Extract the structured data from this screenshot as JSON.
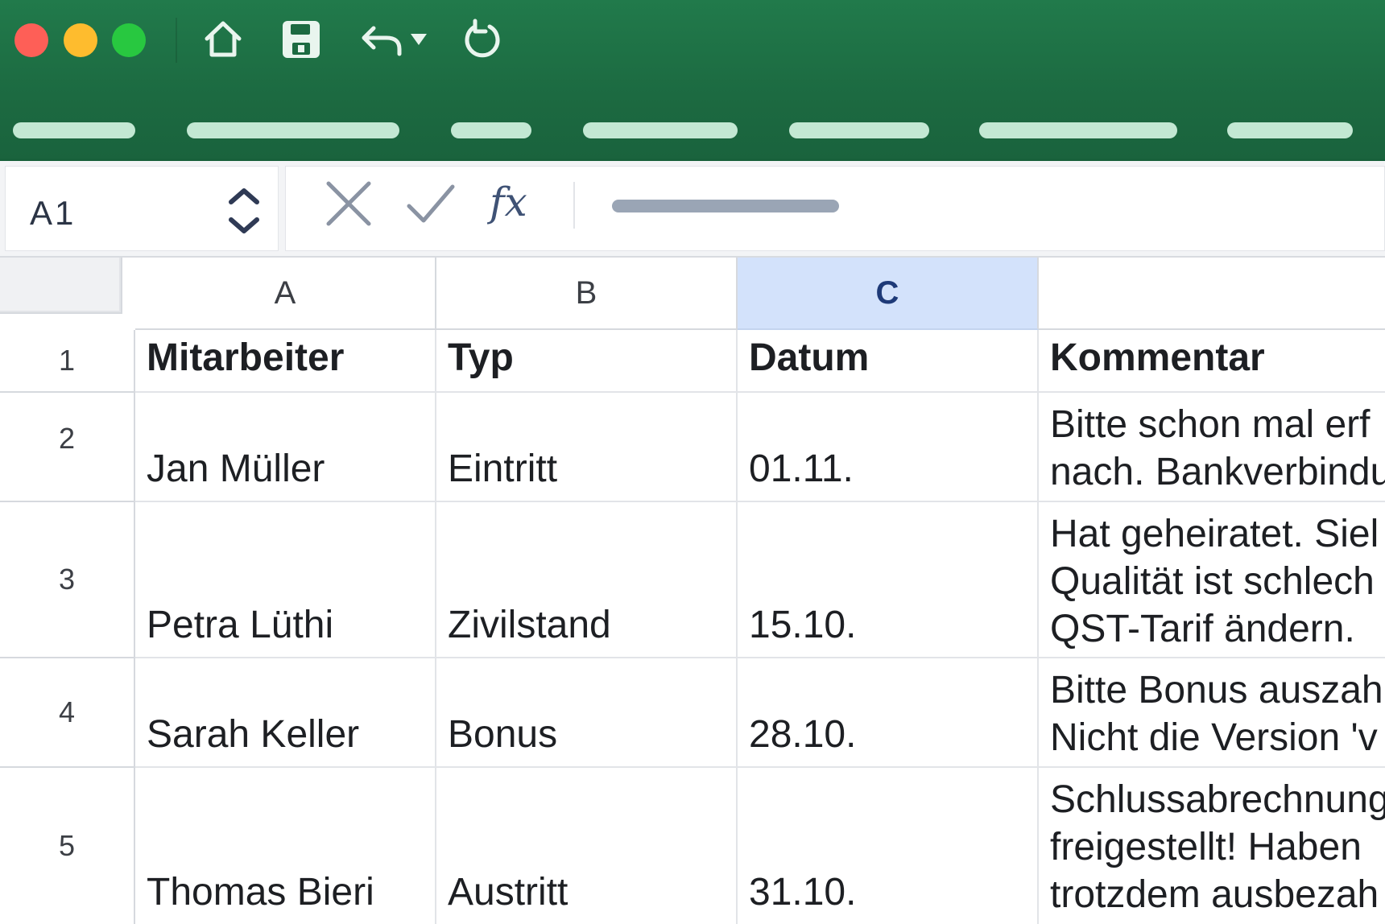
{
  "toolbar": {
    "icons": [
      "home-icon",
      "save-icon",
      "undo-icon",
      "undo-dropdown-icon",
      "redo-icon"
    ],
    "ribbon_tab_count": 7
  },
  "formula_bar": {
    "name_box": "A1",
    "cancel_icon": "close-icon",
    "confirm_icon": "check-icon",
    "fx_label": "fx"
  },
  "grid": {
    "column_headers": [
      "A",
      "B",
      "C",
      ""
    ],
    "selected_column": "C",
    "row_headers": [
      "1",
      "2",
      "3",
      "4",
      "5"
    ],
    "header_row": {
      "a": "Mitarbeiter",
      "b": "Typ",
      "c": "Datum",
      "d": "Kommentar"
    },
    "rows": [
      {
        "a": "Jan Müller",
        "b": "Eintritt",
        "c": "01.11.",
        "d": "Bitte schon mal erf\nnach. Bankverbindu"
      },
      {
        "a": "Petra Lüthi",
        "b": "Zivilstand",
        "c": "15.10.",
        "d": "Hat geheiratet. Siel\nQualität ist schlech\nQST-Tarif ändern."
      },
      {
        "a": "Sarah Keller",
        "b": "Bonus",
        "c": "28.10.",
        "d": "Bitte Bonus auszah\nNicht die Version 'v"
      },
      {
        "a": "Thomas Bieri",
        "b": "Austritt",
        "c": "31.10.",
        "d": "Schlussabrechnung\nfreigestellt! Haben\ntrotzdem ausbezah"
      }
    ]
  },
  "colors": {
    "ribbon": "#1c6a41",
    "selected_column": "#d3e2fb",
    "ribbon_tab": "#c3e8d3"
  }
}
